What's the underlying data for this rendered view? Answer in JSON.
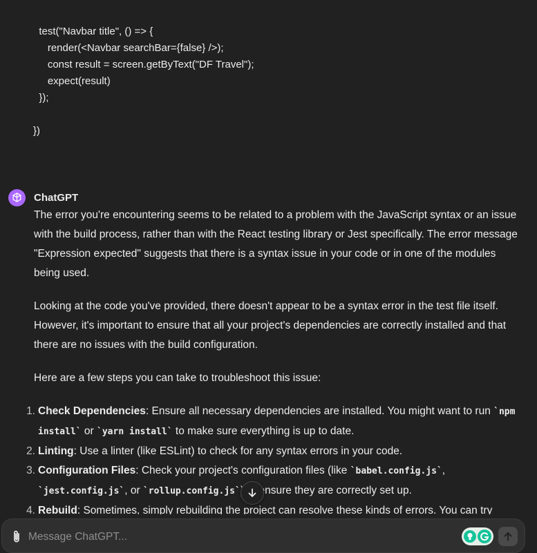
{
  "code": {
    "lines": [
      "  test(\"Navbar title\", () => {",
      "     render(<Navbar searchBar={false} />);",
      "     const result = screen.getByText(\"DF Travel\");",
      "     expect(result)",
      "  });",
      "",
      "})"
    ]
  },
  "assistant": {
    "name": "ChatGPT",
    "intro": "The error you're encountering seems to be related to a problem with the JavaScript syntax or an issue with the build process, rather than with the React testing library or Jest specifically. The error message \"Expression expected\" suggests that there is a syntax issue in your code or in one of the modules being used.",
    "paragraph2": "Looking at the code you've provided, there doesn't appear to be a syntax error in the test file itself. However, it's important to ensure that all your project's dependencies are correctly installed and that there are no issues with the build configuration.",
    "paragraph3": "Here are a few steps you can take to troubleshoot this issue:",
    "steps": [
      {
        "number": "1.",
        "title": "Check Dependencies",
        "text_a": ": Ensure all necessary dependencies are installed. You might want to run ",
        "code1": "`npm install`",
        "text_b": " or ",
        "code2": "`yarn install`",
        "text_c": " to make sure everything is up to date."
      },
      {
        "number": "2.",
        "title": "Linting",
        "text_a": ": Use a linter (like ESLint) to check for any syntax errors in your code."
      },
      {
        "number": "3.",
        "title": "Configuration Files",
        "text_a": ": Check your project's configuration files (like ",
        "code1": "`babel.config.js`",
        "text_b": ", ",
        "code2": "`jest.config.js`",
        "text_c": ", or ",
        "code3": "`rollup.config.js`",
        "text_d": ") to ensure they are correctly set up."
      },
      {
        "number": "4.",
        "title": "Rebuild",
        "text_a": ": Sometimes, simply rebuilding the project can resolve these kinds of errors. You can try"
      }
    ]
  },
  "composer": {
    "placeholder": "Message ChatGPT..."
  },
  "colors": {
    "background": "#212121",
    "avatar": "#ab68ff",
    "composer": "#2f2f2f",
    "grammarly": "#15c39a"
  },
  "icons": {
    "avatar": "openai-logo-icon",
    "scroll": "arrow-down-icon",
    "attach": "paperclip-icon",
    "send": "arrow-up-icon",
    "grammarly": "grammarly-icon"
  }
}
